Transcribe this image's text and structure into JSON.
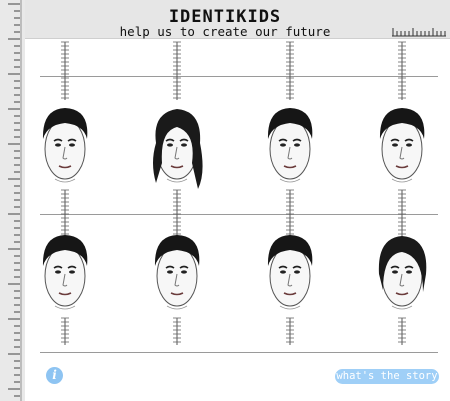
{
  "header": {
    "title": "IDENTIKIDS",
    "subtitle": "help us to create our future"
  },
  "faces": [
    {
      "id": "face-1",
      "hair": "short"
    },
    {
      "id": "face-2",
      "hair": "long"
    },
    {
      "id": "face-3",
      "hair": "short"
    },
    {
      "id": "face-4",
      "hair": "short"
    },
    {
      "id": "face-5",
      "hair": "short"
    },
    {
      "id": "face-6",
      "hair": "short"
    },
    {
      "id": "face-7",
      "hair": "short"
    },
    {
      "id": "face-8",
      "hair": "medium"
    }
  ],
  "footer": {
    "info_label": "i",
    "story_label": "what's the story"
  },
  "colors": {
    "ruler_bg": "#e9e9e9",
    "header_bg": "#e6e6e6",
    "button_blue": "#9fcff7",
    "line_gray": "#9a9a9a"
  }
}
